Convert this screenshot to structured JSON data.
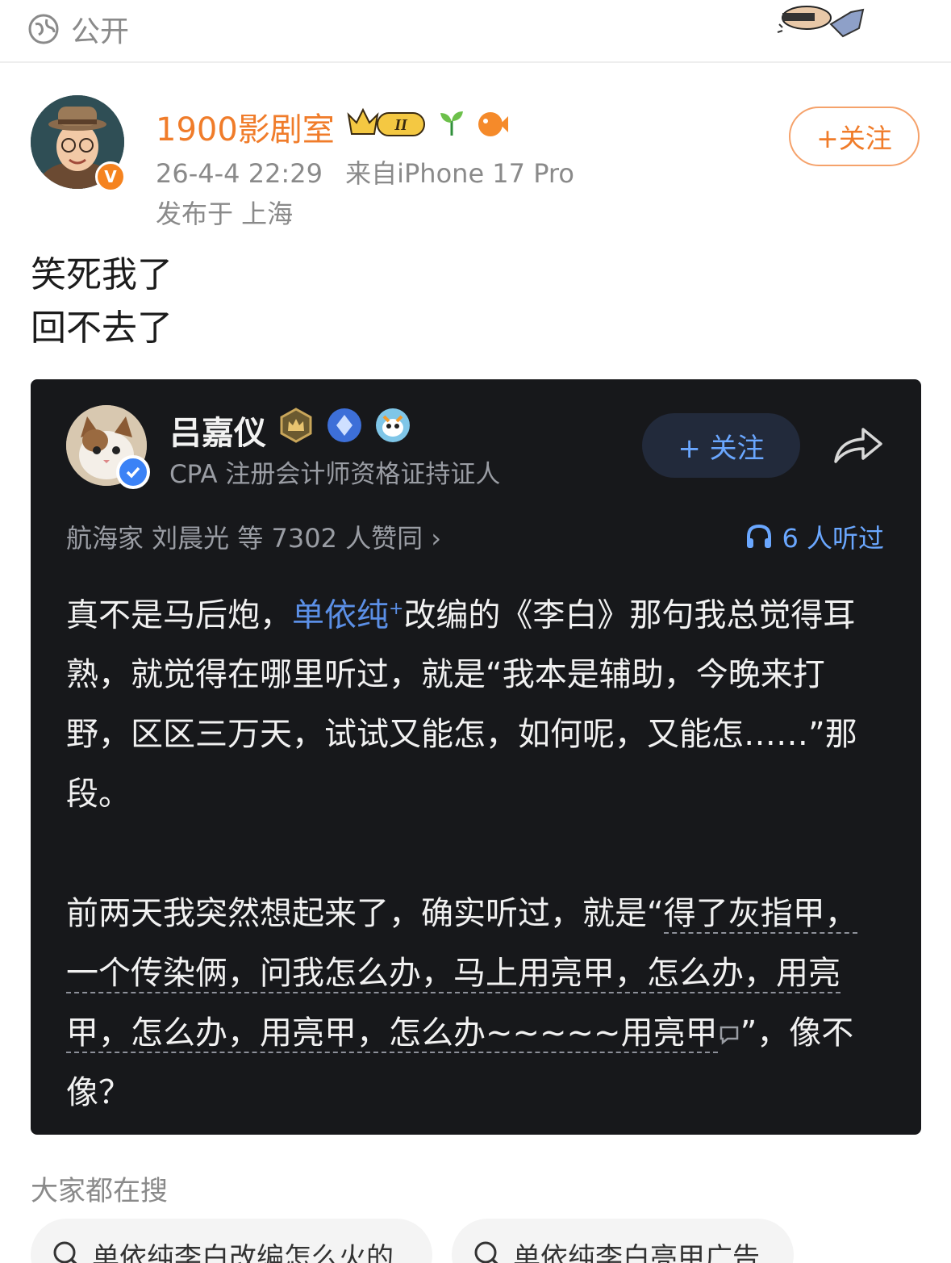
{
  "topbar": {
    "visibility_label": "公开"
  },
  "author": {
    "name": "1900影剧室",
    "verify_mark": "V",
    "level_badge": "II",
    "datetime": "26-4-4 22:29",
    "source_prefix": "来自",
    "device": "iPhone 17 Pro",
    "location": "发布于 上海",
    "follow_label": "+关注"
  },
  "post": {
    "lines": [
      "笑死我了",
      "回不去了"
    ]
  },
  "embedded": {
    "user_name": "吕嘉仪",
    "user_title": "CPA 注册会计师资格证持证人",
    "follow_label": "+ 关注",
    "likes_text": "航海家 刘晨光 等 7302 人赞同 ›",
    "listen_text": "6 人听过",
    "para1_a": "真不是马后炮，",
    "para1_link": "单依纯",
    "para1_sup": "+",
    "para1_b": "改编的《李白》那句我总觉得耳熟，就觉得在哪里听过，就是“我本是辅助，今晚来打野，区区三万天，试试又能怎，如何呢，又能怎……”那段。",
    "para2_a": "前两天我突然想起来了，确实听过，就是“",
    "para2_quote": "得了灰指甲，一个传染俩，问我怎么办，马上用亮甲，怎么办，用亮甲，怎么办，用亮甲，怎么办~~~~~用亮甲",
    "para2_b": "”，像不像？"
  },
  "search": {
    "title": "大家都在搜",
    "chips": [
      "单依纯李白改编怎么火的",
      "单依纯李白亮甲广告"
    ]
  },
  "colors": {
    "accent_orange": "#f07c2a",
    "link_blue": "#5b8fe6",
    "card_bg": "#17181b"
  }
}
